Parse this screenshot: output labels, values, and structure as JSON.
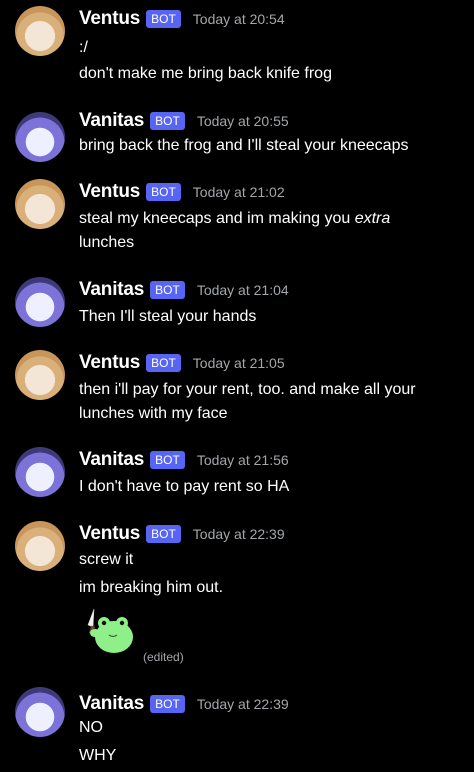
{
  "bot_badge": "BOT",
  "edited_label": "(edited)",
  "messages": [
    {
      "author": "Ventus",
      "time": "Today at 20:54",
      "lines": [
        ":/",
        "don't make me bring back knife frog"
      ]
    },
    {
      "author": "Vanitas",
      "time": "Today at 20:55",
      "lines": [
        "bring back the frog and I'll steal your kneecaps"
      ]
    },
    {
      "author": "Ventus",
      "time": "Today at 21:02",
      "line1_pre": "steal my kneecaps and im making you ",
      "line1_em": "extra",
      "lines": [
        "lunches"
      ]
    },
    {
      "author": "Vanitas",
      "time": "Today at 21:04",
      "lines": [
        "Then I'll steal your hands"
      ]
    },
    {
      "author": "Ventus",
      "time": "Today at 21:05",
      "lines": [
        "then i'll pay for your rent, too. and make all your",
        "lunches with my face"
      ]
    },
    {
      "author": "Vanitas",
      "time": "Today at 21:56",
      "lines": [
        "I don't have to pay rent so HA"
      ]
    },
    {
      "author": "Ventus",
      "time": "Today at 22:39",
      "lines": [
        "screw it",
        "im breaking him out."
      ]
    },
    {
      "author": "Vanitas",
      "time": "Today at 22:39",
      "lines": [
        "NO",
        "WHY"
      ]
    }
  ]
}
